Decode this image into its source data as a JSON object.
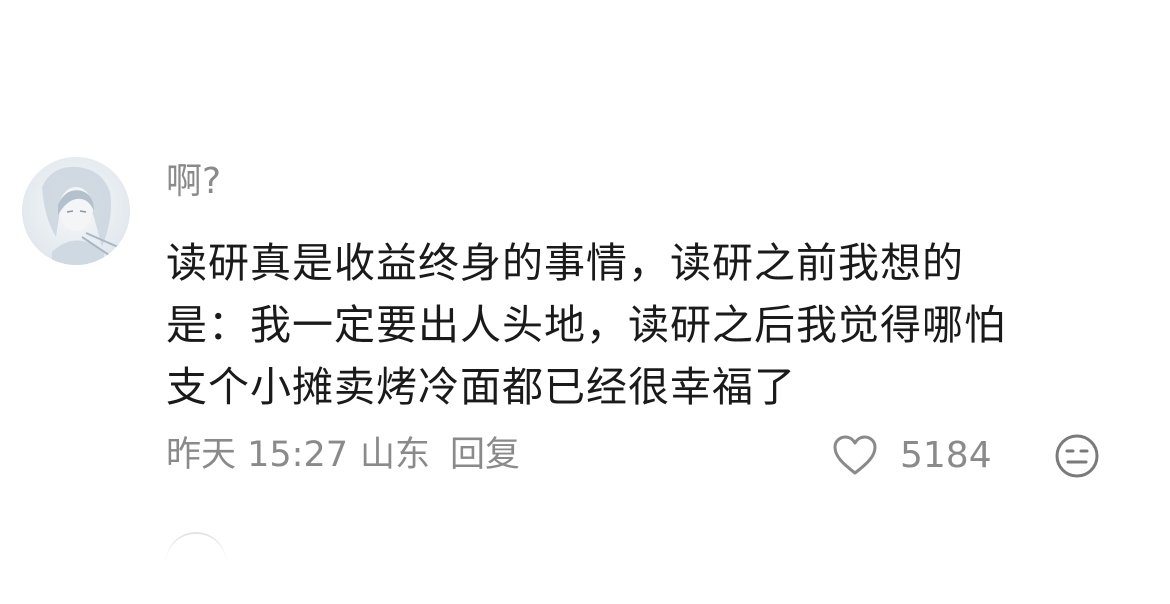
{
  "comment": {
    "username": "啊?",
    "content_lines": [
      "读研真是收益终身的事情，读研之前我想的",
      "是：我一定要出人头地，读研之后我觉得哪怕",
      "支个小摊卖烤冷面都已经很幸福了"
    ],
    "time": "昨天 15:27",
    "location": "山东",
    "reply_label": "回复",
    "like_count": "5184",
    "icons": {
      "like": "heart-outline-icon",
      "emoji": "neutral-face-icon"
    }
  },
  "colors": {
    "text_primary": "#1a1a1a",
    "text_secondary": "#8a8a8a",
    "background": "#ffffff"
  }
}
